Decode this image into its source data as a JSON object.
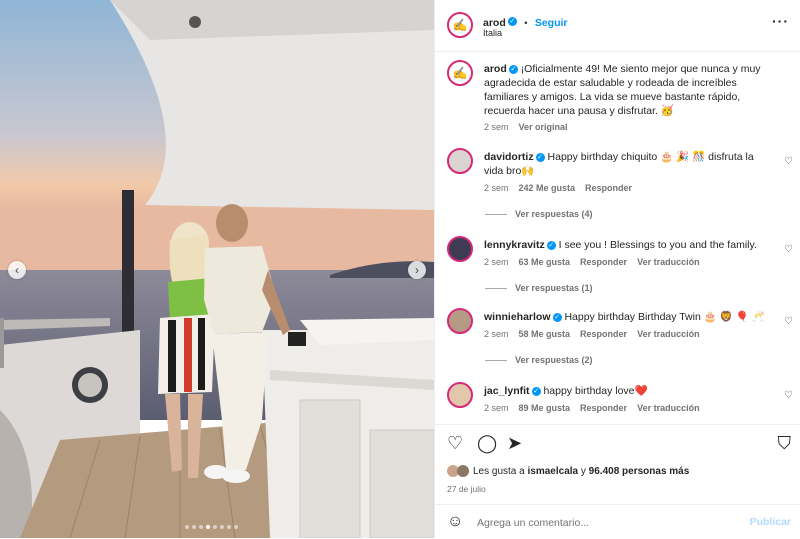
{
  "post": {
    "author": "arod",
    "follow_label": "Seguir",
    "separator": "•",
    "location": "Italia",
    "more_icon": "more-horizontal-icon"
  },
  "caption": {
    "author": "arod",
    "text": "¡Oficialmente 49! Me siento mejor que nunca y muy agradecida de estar saludable y rodeada de increíbles familiares y amigos. La vida se mueve bastante rápido, recuerda hacer una pausa y disfrutar. 🥳",
    "time": "2 sem",
    "see_original": "Ver original"
  },
  "comments": [
    {
      "user": "davidortiz",
      "text": "Happy birthday chiquito 🎂 🎉 🎊 disfruta la vida bro🙌",
      "time": "2 sem",
      "likes": "242 Me gusta",
      "reply": "Responder",
      "translate": "",
      "replies": "Ver respuestas (4)"
    },
    {
      "user": "lennykravitz",
      "text": "I see you ! Blessings to you and the family.",
      "time": "2 sem",
      "likes": "63 Me gusta",
      "reply": "Responder",
      "translate": "Ver traducción",
      "replies": "Ver respuestas (1)"
    },
    {
      "user": "winnieharlow",
      "text": "Happy birthday Birthday Twin 🎂 🦁 🎈 🥂",
      "time": "2 sem",
      "likes": "58 Me gusta",
      "reply": "Responder",
      "translate": "Ver traducción",
      "replies": "Ver respuestas (2)"
    },
    {
      "user": "jac_lynfit",
      "text": "happy birthday love❤️",
      "time": "2 sem",
      "likes": "89 Me gusta",
      "reply": "Responder",
      "translate": "Ver traducción",
      "replies": ""
    }
  ],
  "likes": {
    "prefix": "Les gusta a",
    "user": "ismaelcala",
    "joiner": "y",
    "count": "96.408 personas más",
    "date": "27 de julio"
  },
  "composer": {
    "placeholder": "Agrega un comentario...",
    "publish": "Publicar"
  },
  "carousel": {
    "slides": 8,
    "active": 3
  },
  "colors": {
    "accent": "#0095f6",
    "text": "#262626",
    "muted": "#737373",
    "ring": "#d62976"
  }
}
